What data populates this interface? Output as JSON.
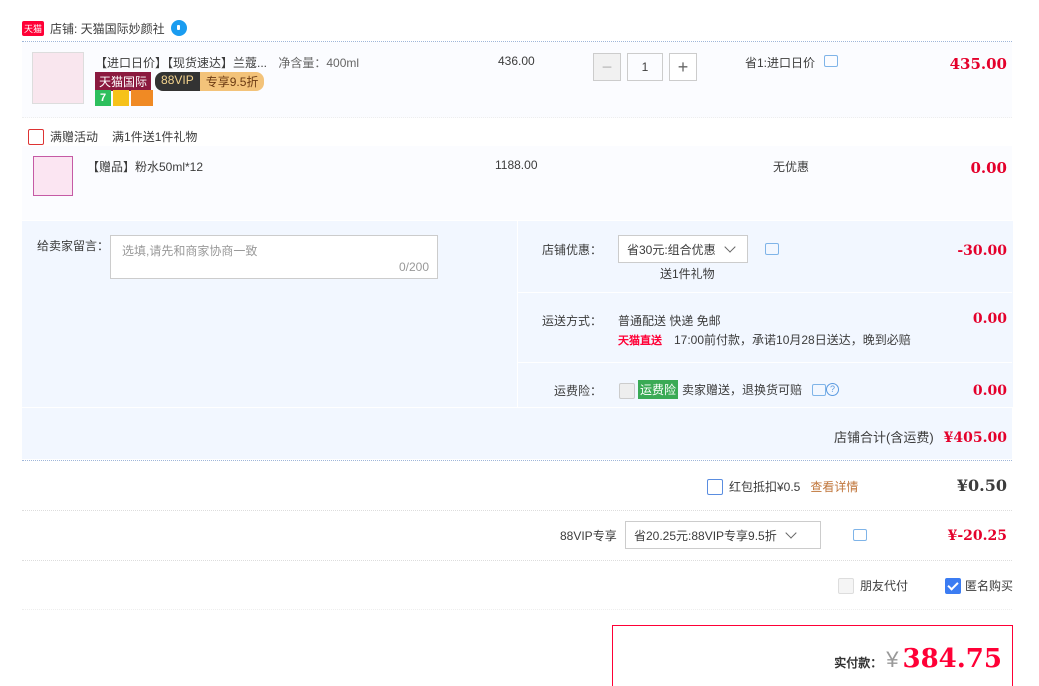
{
  "shop": {
    "tag": "天猫",
    "name": "店铺: 天猫国际妙颜社"
  },
  "item": {
    "title": "【进口日价】【现货速达】兰蔻...",
    "spec": "净含量：400ml",
    "badges": {
      "tmall": "天猫国际",
      "vip": "88VIP",
      "vip_discount": "专享9.5折",
      "seven": "7"
    },
    "price": "436.00",
    "quantity": "1",
    "promo": "省1:进口日价",
    "total": "435.00"
  },
  "gift_activity": {
    "label": "满赠活动",
    "text": "满1件送1件礼物"
  },
  "gift_item": {
    "title": "【赠品】粉水50ml*12",
    "price": "1188.00",
    "promo": "无优惠",
    "total": "0.00"
  },
  "message": {
    "label": "给卖家留言：",
    "placeholder": "选填,请先和商家协商一致",
    "count": "0/200"
  },
  "shop_discount": {
    "label": "店铺优惠：",
    "selected": "省30元:组合优惠",
    "note": "送1件礼物",
    "amount": "-30.00"
  },
  "shipping": {
    "label": "运送方式：",
    "method": "普通配送 快递 免邮",
    "tmall_direct": "天猫直送",
    "promise": "17:00前付款，承诺10月28日送达，晚到必赔",
    "amount": "0.00"
  },
  "insurance": {
    "label": "运费险：",
    "badge": "运费险",
    "text": "卖家赠送，退换货可赔",
    "amount": "0.00"
  },
  "shop_total": {
    "label": "店铺合计(含运费)",
    "amount": "¥405.00"
  },
  "red_packet": {
    "label": "红包抵扣¥0.5",
    "link": "查看详情",
    "amount": "¥0.50"
  },
  "vip": {
    "label": "88VIP专享",
    "selected": "省20.25元:88VIP专享9.5折",
    "amount": "¥-20.25"
  },
  "options": {
    "friend_pay": "朋友代付",
    "anonymous": "匿名购买"
  },
  "payment": {
    "label": "实付款：",
    "currency": "¥",
    "amount": "384.75"
  }
}
